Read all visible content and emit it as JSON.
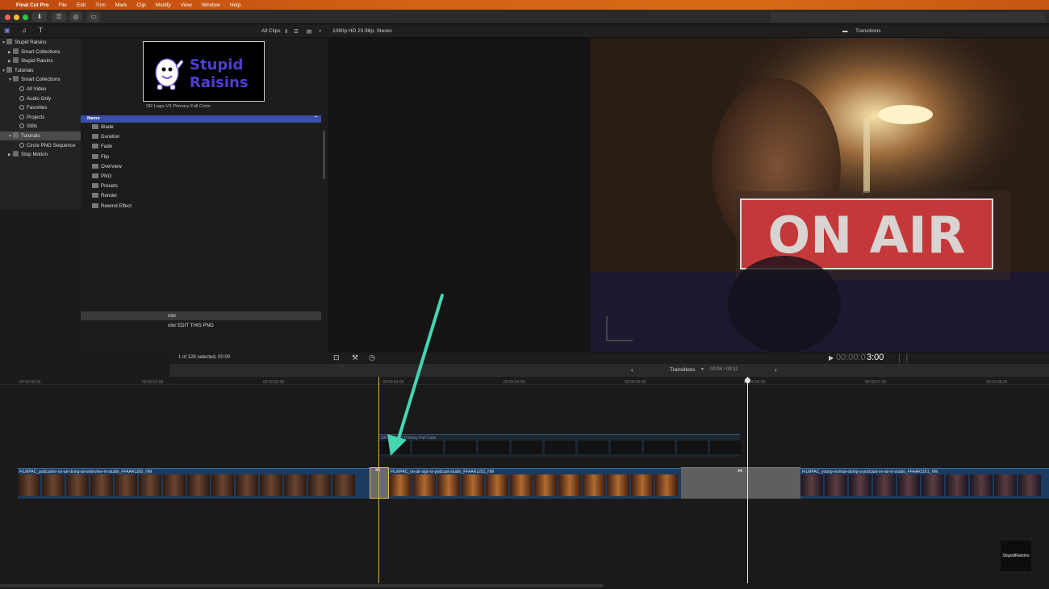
{
  "menubar": {
    "apple": "",
    "app": "Final Cut Pro",
    "items": [
      "File",
      "Edit",
      "Trim",
      "Mark",
      "Clip",
      "Modify",
      "View",
      "Window",
      "Help"
    ]
  },
  "browser_header": {
    "filter": "All Clips",
    "format": "1080p HD 23.98p, Stereo",
    "inspector_title": "Transitions"
  },
  "sidebar": {
    "items": [
      {
        "label": "Stupid Raisins",
        "indent": 0,
        "tri": "▼"
      },
      {
        "label": "Smart Collections",
        "indent": 1,
        "tri": "▶"
      },
      {
        "label": "Stupid Raisins",
        "indent": 1,
        "tri": "▶"
      },
      {
        "label": "Tutorials",
        "indent": 0,
        "tri": "▼"
      },
      {
        "label": "Smart Collections",
        "indent": 1,
        "tri": "▼"
      },
      {
        "label": "All Video",
        "indent": 2,
        "tri": ""
      },
      {
        "label": "Audio Only",
        "indent": 2,
        "tri": ""
      },
      {
        "label": "Favorites",
        "indent": 2,
        "tri": ""
      },
      {
        "label": "Projects",
        "indent": 2,
        "tri": ""
      },
      {
        "label": "Stills",
        "indent": 2,
        "tri": ""
      },
      {
        "label": "Tutorials",
        "indent": 1,
        "tri": "▼",
        "selected": true
      },
      {
        "label": "Circle PNG Sequence",
        "indent": 2,
        "tri": ""
      },
      {
        "label": "Stop Motion",
        "indent": 1,
        "tri": "▶"
      }
    ]
  },
  "logo": {
    "line1": "Stupid",
    "line2": "Raisins",
    "caption": "SR Logo-V2 Primary-Full Color",
    "color": "#4c3fd0"
  },
  "list": {
    "header": "Name",
    "folders": [
      "Blade",
      "Duration",
      "Fade",
      "Flip",
      "Overview",
      "PNG",
      "Presets",
      "Render",
      "Rewind Effect"
    ],
    "clip_row_1": "olor",
    "clip_row_2": "olor EDIT THIS PNG",
    "status": "1 of 128 selected, 00:00"
  },
  "viewer": {
    "sign": "ON AIR",
    "timecode_dim": "00:00:0",
    "timecode_bright": "3:00"
  },
  "timeline": {
    "index_title": "Transitions",
    "position": "00:04 / 09:11",
    "ruler": [
      "00:00:00:00",
      "00:00:01:00",
      "00:00:02:00",
      "00:00:03:00",
      "00:00:04:00",
      "00:00:05:00",
      "00:00:06:00",
      "00:00:07:00",
      "00:00:08:00"
    ],
    "connected_clip": "SR Logo-V2 Primary-Full Color",
    "clips": [
      "FILMPAC_podcaster-on-air-doing-an-interview-in-studio_FFAAR1262_HM",
      "FILMPAC_on-air-sign-in-podcast-studio_FFAAR1201_HM",
      "FILMPAC_young-woman-doing-a-podcast-on-air-in-studio_FFAAR1161_HM"
    ],
    "watermark": "StupidRaisins"
  }
}
